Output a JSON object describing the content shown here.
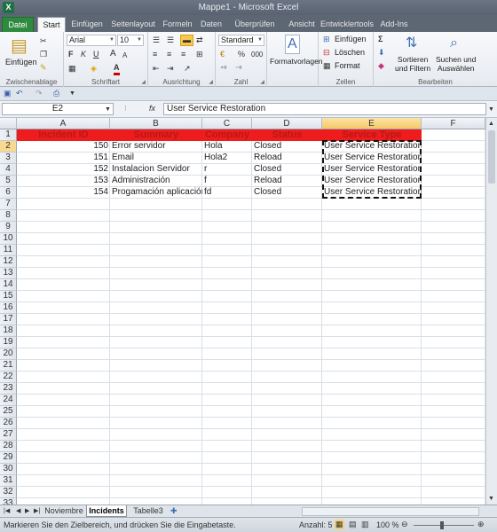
{
  "window": {
    "title": "Mappe1 - Microsoft Excel",
    "app_icon": "X"
  },
  "tabs": {
    "file": "Datei",
    "items": [
      "Start",
      "Einfügen",
      "Seitenlayout",
      "Formeln",
      "Daten",
      "Überprüfen",
      "Ansicht",
      "Entwicklertools",
      "Add-Ins"
    ]
  },
  "ribbon": {
    "clipboard": {
      "paste": "Einfügen",
      "label": "Zwischenablage"
    },
    "font": {
      "name": "Arial",
      "size": "10",
      "label": "Schriftart",
      "bold": "F",
      "italic": "K",
      "underline": "U",
      "grow": "A",
      "shrink": "A",
      "fontcolor": "A"
    },
    "alignment": {
      "label": "Ausrichtung"
    },
    "number": {
      "format": "Standard",
      "percent": "%",
      "thousands": "000",
      "label": "Zahl"
    },
    "styles": {
      "format_templates": "Formatvorlagen"
    },
    "cells": {
      "insert": "Einfügen",
      "delete": "Löschen",
      "format": "Format",
      "label": "Zellen"
    },
    "editing": {
      "sort": "Sortieren\nund Filtern",
      "find": "Suchen und\nAuswählen",
      "label": "Bearbeiten",
      "sigma": "Σ"
    }
  },
  "formula_bar": {
    "cell_ref": "E2",
    "fx": "fx",
    "content": "User Service Restoration"
  },
  "grid": {
    "columns": [
      "A",
      "B",
      "C",
      "D",
      "E",
      "F"
    ],
    "headers": [
      "Incident ID",
      "Summary",
      "Company",
      "Status",
      "Service Type"
    ],
    "rows": [
      [
        "150",
        "Error servidor",
        "Hola",
        "Closed",
        "User Service Restoration"
      ],
      [
        "151",
        "Email",
        "Hola2",
        "Reload",
        "User Service Restoration"
      ],
      [
        "152",
        "Instalacion Servidor",
        "r",
        "Closed",
        "User Service Restoration"
      ],
      [
        "153",
        "Administración",
        "f",
        "Reload",
        "User Service Restoration"
      ],
      [
        "154",
        "Progamación aplicación",
        "fd",
        "Closed",
        "User Service Restoration"
      ]
    ],
    "row_numbers": [
      "1",
      "2",
      "3",
      "4",
      "5",
      "6",
      "7",
      "8",
      "9",
      "10",
      "11",
      "12",
      "13",
      "14",
      "15",
      "16",
      "17",
      "18",
      "19",
      "20",
      "21",
      "22",
      "23",
      "24",
      "25",
      "26",
      "27",
      "28",
      "29",
      "30",
      "31",
      "32",
      "33"
    ]
  },
  "sheets": {
    "items": [
      "Noviembre",
      "Incidents",
      "Tabelle3"
    ],
    "active": "Incidents"
  },
  "status": {
    "message": "Markieren Sie den Zielbereich, und drücken Sie die Eingabetaste.",
    "count": "Anzahl: 5",
    "zoom": "100 %"
  },
  "colors": {
    "header_fill": "#ee1c1c",
    "header_text": "#b81818",
    "file_tab": "#2e8a3e"
  }
}
